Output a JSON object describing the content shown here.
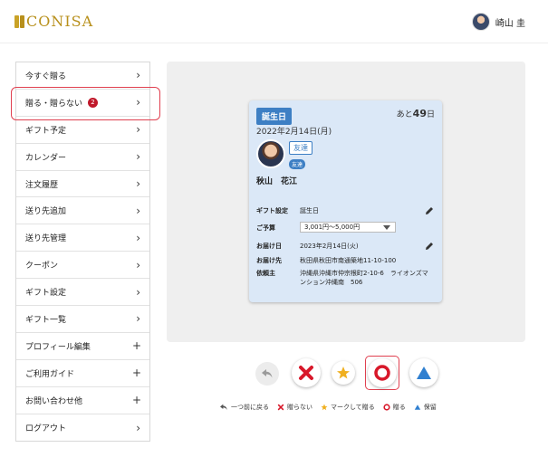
{
  "header": {
    "logo_text": "CONISA",
    "user_name": "崎山 圭"
  },
  "sidebar": {
    "items": [
      {
        "label": "今すぐ贈る",
        "icon": "chevron-right-icon"
      },
      {
        "label": "贈る・贈らない",
        "icon": "chevron-right-icon",
        "badge": "2"
      },
      {
        "label": "ギフト予定",
        "icon": "chevron-right-icon"
      },
      {
        "label": "カレンダー",
        "icon": "chevron-right-icon"
      },
      {
        "label": "注文履歴",
        "icon": "chevron-right-icon"
      },
      {
        "label": "送り先追加",
        "icon": "chevron-right-icon"
      },
      {
        "label": "送り先管理",
        "icon": "chevron-right-icon"
      },
      {
        "label": "クーポン",
        "icon": "chevron-right-icon"
      },
      {
        "label": "ギフト設定",
        "icon": "chevron-right-icon"
      },
      {
        "label": "ギフト一覧",
        "icon": "chevron-right-icon"
      },
      {
        "label": "プロフィール編集",
        "icon": "plus-icon"
      },
      {
        "label": "ご利用ガイド",
        "icon": "plus-icon"
      },
      {
        "label": "お問い合わせ他",
        "icon": "plus-icon"
      },
      {
        "label": "ログアウト",
        "icon": "chevron-right-icon"
      }
    ]
  },
  "card": {
    "event_tag": "誕生日",
    "days_prefix": "あと",
    "days_value": "49",
    "days_suffix": "日",
    "date": "2022年2月14日(月)",
    "relation": "友達",
    "relation_chip": "友達",
    "person_name": "秋山　花江",
    "gift_setting_label": "ギフト設定",
    "gift_setting_value": "誕生日",
    "budget_label": "ご予算",
    "budget_value": "3,001円〜5,000円",
    "delivery_date_label": "お届け日",
    "delivery_date_value": "2023年2月14日(火)",
    "delivery_to_label": "お届け先",
    "delivery_to_value": "秋田県秋田市南通築地11-10-100",
    "requester_label": "依頼主",
    "requester_value": "沖縄県沖縄市仲宗根町2-10-6　ライオンズマンション沖縄南　506"
  },
  "legend": {
    "back": "一つ前に戻る",
    "no": "贈らない",
    "mark": "マークして贈る",
    "yes": "贈る",
    "hold": "保留"
  },
  "colors": {
    "brand_gold": "#b8901c",
    "accent_blue": "#3d7fc4",
    "no_red": "#d8182a",
    "mark_yellow": "#f0b020",
    "hold_blue": "#2f7fd0",
    "highlight_red": "#e04050"
  }
}
